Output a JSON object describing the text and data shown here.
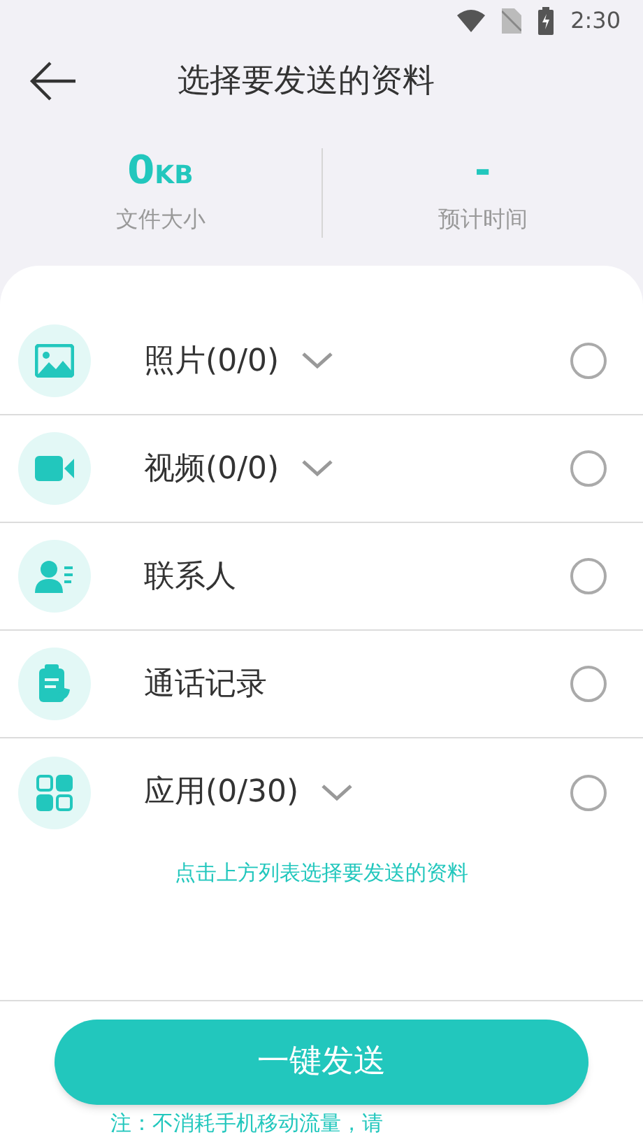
{
  "status_bar": {
    "time": "2:30"
  },
  "header": {
    "title": "选择要发送的资料"
  },
  "stats": [
    {
      "value": "0",
      "unit": "KB",
      "label": "文件大小"
    },
    {
      "value": "-",
      "label": "预计时间"
    }
  ],
  "items": [
    {
      "label": "照片(0/0)",
      "expandable": true,
      "checked": false
    },
    {
      "label": "视频(0/0)",
      "expandable": true,
      "checked": false
    },
    {
      "label": "联系人",
      "expandable": false,
      "checked": false
    },
    {
      "label": "通话记录",
      "expandable": false,
      "checked": false
    },
    {
      "label": "应用(0/30)",
      "expandable": true,
      "checked": false
    }
  ],
  "hint": "点击上方列表选择要发送的资料",
  "send_button": "一键发送",
  "note": "注：不消耗手机移动流量，请"
}
